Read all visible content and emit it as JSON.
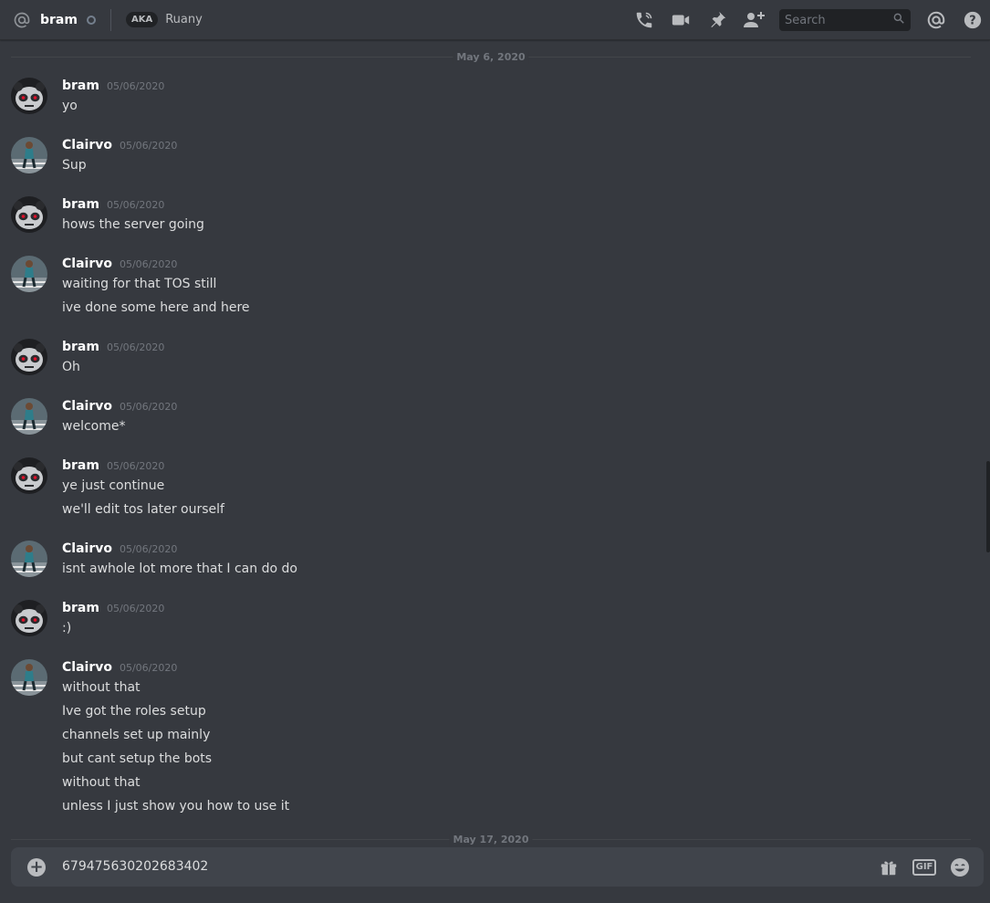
{
  "header": {
    "channel_name": "bram",
    "aka_label": "AKA",
    "aka_name": "Ruany",
    "search_placeholder": "Search",
    "icons": [
      "phone-call-icon",
      "video-call-icon",
      "pin-icon",
      "add-friend-icon",
      "search-icon",
      "mention-icon",
      "help-icon"
    ]
  },
  "dividers": [
    "May 6, 2020",
    "May 17, 2020"
  ],
  "messages": [
    {
      "author": "bram",
      "time": "05/06/2020",
      "lines": [
        "yo"
      ]
    },
    {
      "author": "Clairvo",
      "time": "05/06/2020",
      "lines": [
        "Sup"
      ]
    },
    {
      "author": "bram",
      "time": "05/06/2020",
      "lines": [
        "hows the server going"
      ]
    },
    {
      "author": "Clairvo",
      "time": "05/06/2020",
      "lines": [
        "waiting for that TOS still",
        "ive done some here and here"
      ]
    },
    {
      "author": "bram",
      "time": "05/06/2020",
      "lines": [
        "Oh"
      ]
    },
    {
      "author": "Clairvo",
      "time": "05/06/2020",
      "lines": [
        "welcome*"
      ]
    },
    {
      "author": "bram",
      "time": "05/06/2020",
      "lines": [
        "ye just continue",
        "we'll edit tos later ourself"
      ]
    },
    {
      "author": "Clairvo",
      "time": "05/06/2020",
      "lines": [
        "isnt awhole lot more that I can do do"
      ]
    },
    {
      "author": "bram",
      "time": "05/06/2020",
      "lines": [
        ":)"
      ]
    },
    {
      "author": "Clairvo",
      "time": "05/06/2020",
      "lines": [
        "without that",
        "Ive got the roles setup",
        "channels set up mainly",
        "but cant setup the bots",
        "without that",
        "unless I just show you how to use it"
      ]
    }
  ],
  "composer": {
    "value": "679475630202683402",
    "gif_label": "GIF",
    "icons": [
      "add-attachment-icon",
      "gift-icon",
      "gif-icon",
      "emoji-icon"
    ]
  },
  "colors": {
    "background": "#36393f",
    "input_bg": "#40444b",
    "header_text": "#ffffff",
    "muted": "#72767d",
    "bram_eyes": "#e0102a"
  }
}
